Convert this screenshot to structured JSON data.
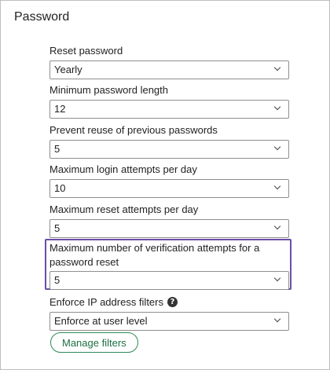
{
  "section": {
    "title": "Password"
  },
  "fields": [
    {
      "label": "Reset password",
      "value": "Yearly"
    },
    {
      "label": "Minimum password length",
      "value": "12"
    },
    {
      "label": "Prevent reuse of previous passwords",
      "value": "5"
    },
    {
      "label": "Maximum login attempts per day",
      "value": "10"
    },
    {
      "label": "Maximum reset attempts per day",
      "value": "5"
    },
    {
      "label": "Maximum number of verification attempts for a password reset",
      "value": "5"
    },
    {
      "label": "Enforce IP address filters",
      "value": "Enforce at user level"
    }
  ],
  "icons": {
    "help": "?"
  },
  "buttons": {
    "manage_filters": "Manage filters"
  },
  "colors": {
    "highlight": "#6b4ea8",
    "button_accent": "#2e8b57"
  }
}
